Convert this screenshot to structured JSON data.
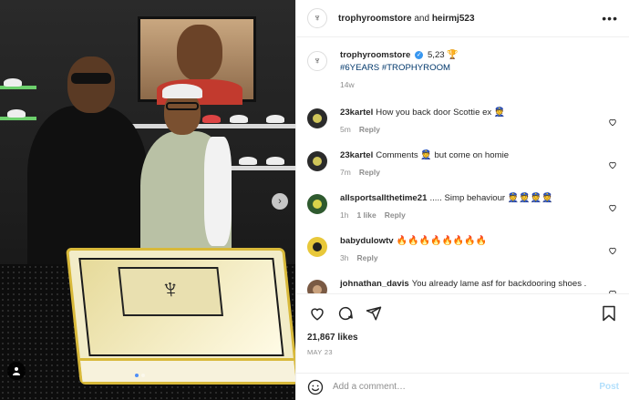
{
  "header": {
    "owner": "trophyroomstore",
    "and_text": " and ",
    "collaborator": "heirmj523",
    "more_glyph": "•••"
  },
  "caption": {
    "user": "trophyroomstore",
    "text_prefix": " 5,23 ",
    "trophy": "🏆",
    "hashtags": "#6YEARS #TROPHYROOM",
    "time": "14w"
  },
  "comments": [
    {
      "user": "23kartel",
      "text": "How you back door Scottie ex",
      "emoji": "👮",
      "time": "5m",
      "likes": "",
      "reply": "Reply"
    },
    {
      "user": "23kartel",
      "text": "Comments",
      "emoji_mid": "👮",
      "text_after": "but come on homie",
      "time": "7m",
      "likes": "",
      "reply": "Reply"
    },
    {
      "user": "allsportsallthetime21",
      "text": "..... Simp behaviour",
      "emoji": "👮👮👮👮",
      "time": "1h",
      "likes": "1 like",
      "reply": "Reply"
    },
    {
      "user": "babydulowtv",
      "text": "",
      "emoji": "🔥🔥🔥🔥🔥🔥🔥🔥",
      "time": "3h",
      "likes": "",
      "reply": "Reply"
    },
    {
      "user": "johnathan_davis",
      "text": "You already lame asf for backdooring shoes .",
      "emoji": "",
      "time": "",
      "likes": "",
      "reply": ""
    }
  ],
  "engagement": {
    "likes": "21,867 likes",
    "date": "MAY 23"
  },
  "add_comment": {
    "placeholder": "Add a comment…",
    "post_label": "Post"
  },
  "colors": {
    "verified": "#3897f0",
    "link": "#00376b",
    "muted": "#8e8e8e",
    "post_disabled": "#b2dffc",
    "carousel_active": "#4f8ef7"
  },
  "icons": [
    "more-icon",
    "verified-icon",
    "heart-icon",
    "comment-icon",
    "share-icon",
    "bookmark-icon",
    "emoji-icon",
    "next-icon",
    "user-tag-icon"
  ]
}
